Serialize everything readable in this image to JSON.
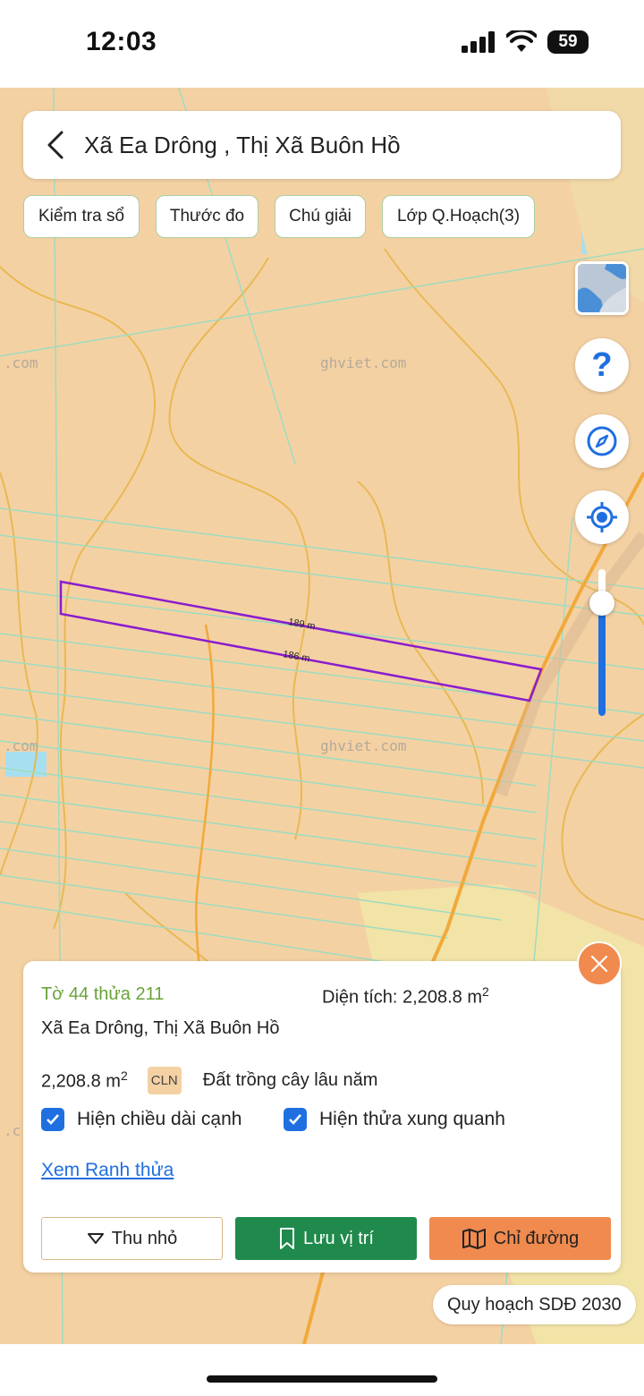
{
  "status_bar": {
    "time": "12:03",
    "battery": "59"
  },
  "header": {
    "title": "Xã Ea Drông , Thị Xã Buôn Hồ"
  },
  "chips": [
    "Kiểm tra sổ",
    "Thước đo",
    "Chú giải",
    "Lớp Q.Hoạch(3)"
  ],
  "map": {
    "watermarks": [
      "ghviet.com",
      "ghviet.com",
      ".com",
      ".com",
      ".c"
    ],
    "edge_labels": [
      "189 m",
      "186 m"
    ],
    "colors": {
      "land": "#f4d1a3",
      "parcel_outline": "#8a1ccf",
      "parcel_lines": "#9edcc0",
      "contours": "#e7b64a",
      "road": "#f1a93a",
      "water": "#a8dff0"
    }
  },
  "controls": {
    "help": "?",
    "icons": [
      "map-layer-icon",
      "help-icon",
      "compass-icon",
      "locate-icon"
    ],
    "zoom_level": 0.76
  },
  "panel": {
    "parcel_id": "Tờ 44 thửa 211",
    "area_label": "Diện tích: 2,208.8 m",
    "area_sup": "2",
    "location": "Xã Ea Drông, Thị Xã Buôn Hồ",
    "area_value": "2,208.8 m",
    "area_value_sup": "2",
    "land_code": "CLN",
    "land_type": "Đất trồng cây lâu năm",
    "checkbox_edges": "Hiện chiều dài cạnh",
    "checkbox_neighbors": "Hiện thửa xung quanh",
    "link": "Xem Ranh thửa",
    "buttons": {
      "minimize": "Thu nhỏ",
      "save": "Lưu vị trí",
      "directions": "Chỉ đường"
    }
  },
  "plan_label": "Quy hoạch SDĐ 2030"
}
